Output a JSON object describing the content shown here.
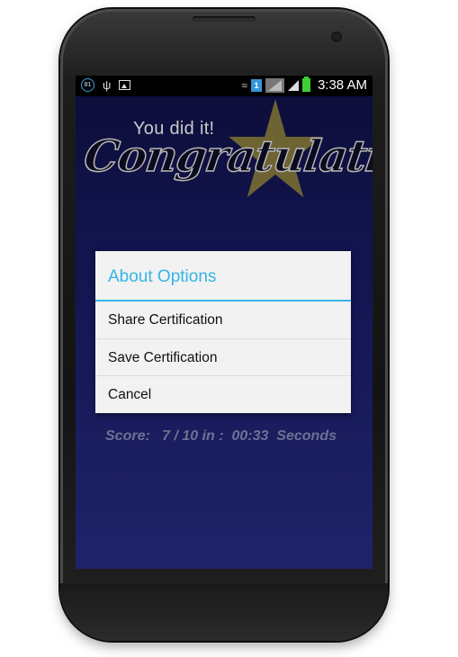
{
  "status_bar": {
    "notification_badge": "81",
    "icons": [
      "usb-icon",
      "image-icon",
      "wifi-icon",
      "sim-icon",
      "signal-icon",
      "signal-icon",
      "battery-charging-icon"
    ],
    "sim_label": "1",
    "time": "3:38 AM"
  },
  "header_art": {
    "subtitle": "You did it!",
    "title": "Congratulations",
    "star_color": "#6e6333"
  },
  "dialog": {
    "title": "About Options",
    "accent_color": "#33b5e5",
    "items": [
      {
        "label": "Share Certification"
      },
      {
        "label": "Save Certification"
      },
      {
        "label": "Cancel"
      }
    ]
  },
  "score": {
    "text": "Score:   7 / 10 in :  00:33  Seconds"
  }
}
